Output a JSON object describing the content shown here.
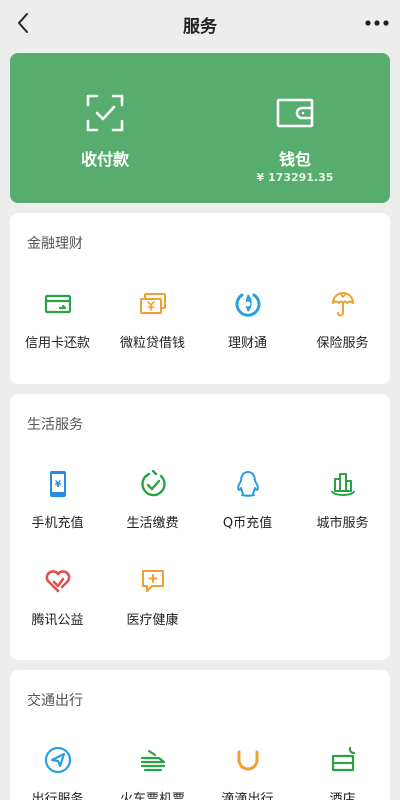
{
  "header": {
    "title": "服务",
    "back_icon": "back-chevron-icon",
    "more_icon": "more-dots-icon"
  },
  "hero": {
    "background": "#57ad6e",
    "pay": {
      "label": "收付款",
      "icon": "scan-pay-icon"
    },
    "wallet": {
      "label": "钱包",
      "balance": "¥ 173291.35",
      "icon": "wallet-icon"
    }
  },
  "sections": {
    "finance": {
      "title": "金融理财",
      "items": [
        {
          "label": "信用卡还款",
          "icon": "credit-card-repay-icon",
          "color": "#2ba245"
        },
        {
          "label": "微粒贷借钱",
          "icon": "loan-icon",
          "color": "#f0a030"
        },
        {
          "label": "理财通",
          "icon": "wealth-icon",
          "color": "#2a9fe0"
        },
        {
          "label": "保险服务",
          "icon": "insurance-icon",
          "color": "#f0a030"
        }
      ]
    },
    "life": {
      "title": "生活服务",
      "items": [
        {
          "label": "手机充值",
          "icon": "phone-topup-icon",
          "color": "#2a8be0"
        },
        {
          "label": "生活缴费",
          "icon": "utility-bill-icon",
          "color": "#2ba245"
        },
        {
          "label": "Q币充值",
          "icon": "qq-coin-icon",
          "color": "#2a9fe0"
        },
        {
          "label": "城市服务",
          "icon": "city-service-icon",
          "color": "#2ba245"
        },
        {
          "label": "腾讯公益",
          "icon": "charity-icon",
          "color": "#e05050"
        },
        {
          "label": "医疗健康",
          "icon": "medical-icon",
          "color": "#f0a030"
        }
      ]
    },
    "transport": {
      "title": "交通出行",
      "items": [
        {
          "label": "出行服务",
          "icon": "travel-service-icon",
          "color": "#2a9fe0"
        },
        {
          "label": "火车票机票",
          "icon": "train-ticket-icon",
          "color": "#2ba245"
        },
        {
          "label": "滴滴出行",
          "icon": "didi-icon",
          "color": "#f0a030"
        },
        {
          "label": "酒店",
          "icon": "hotel-icon",
          "color": "#2ba245"
        }
      ]
    }
  }
}
